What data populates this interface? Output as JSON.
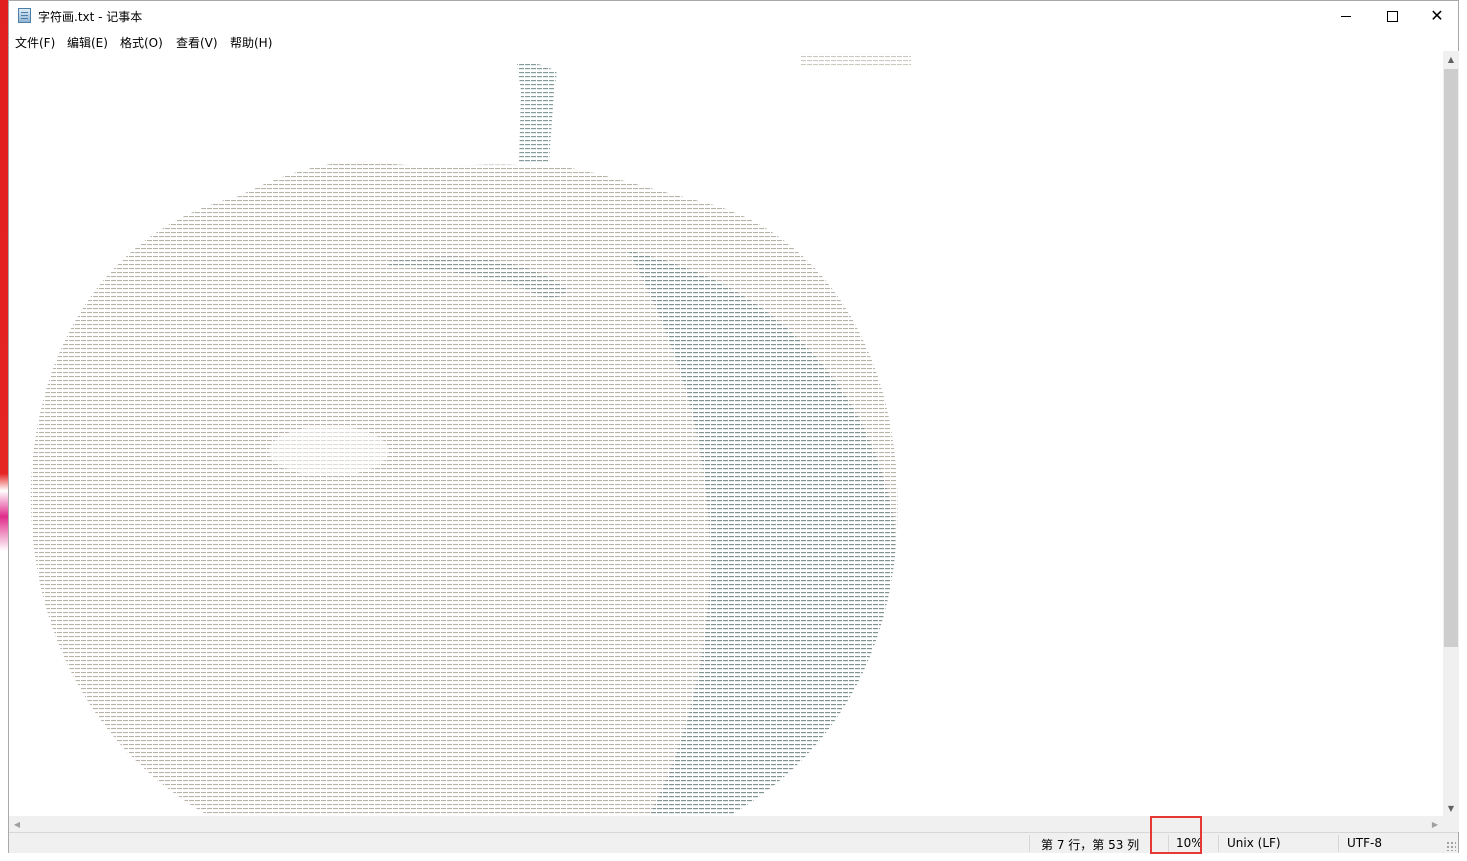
{
  "window": {
    "title": "字符画.txt - 记事本",
    "icon": "notepad-icon",
    "controls": {
      "minimize_icon": "minimize-icon",
      "maximize_icon": "maximize-icon",
      "close_icon": "close-icon",
      "close_glyph": "✕"
    }
  },
  "menu": [
    {
      "label": "文件(F)"
    },
    {
      "label": "编辑(E)"
    },
    {
      "label": "格式(O)"
    },
    {
      "label": "查看(V)"
    },
    {
      "label": "帮助(H)"
    }
  ],
  "editor": {
    "content": "ASCII-art apple rendered with tiny characters",
    "colors": {
      "background": "#ffffff",
      "art_light": "#b8b2a8",
      "art_dark": "#6f8a8a"
    }
  },
  "scrollbars": {
    "up_glyph": "▲",
    "down_glyph": "▼",
    "left_glyph": "◀",
    "right_glyph": "▶"
  },
  "status": {
    "position": "第 7 行，第 53 列",
    "zoom": "10%",
    "line_ending": "Unix (LF)",
    "encoding": "UTF-8"
  }
}
